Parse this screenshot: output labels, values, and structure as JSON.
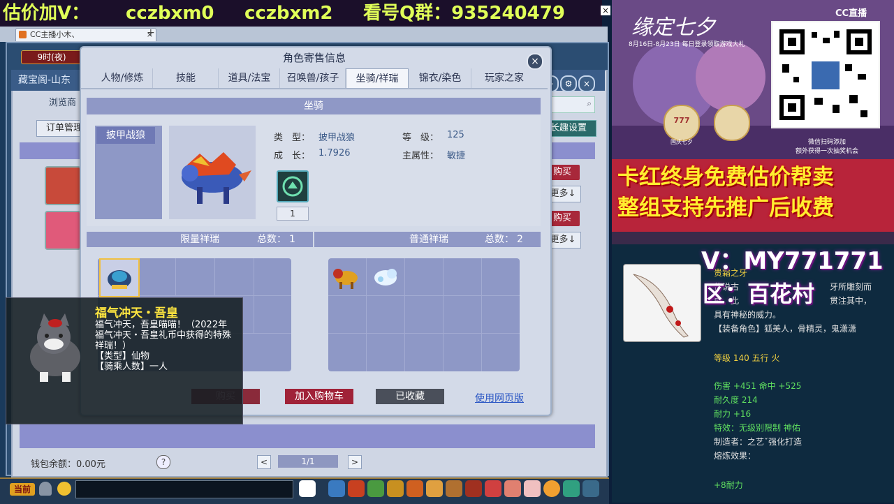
{
  "banner": {
    "part1": "估价加V：",
    "part2": "cczbxm0",
    "part3": "cczbxm2",
    "part4": "看号Q群：935240479"
  },
  "browser": {
    "tab_label": "CC主播小木、",
    "close_label": "×",
    "new_tab_label": "+"
  },
  "game": {
    "clock": "9时(夜)",
    "shop_title": "藏宝阁-山东",
    "browse_label": "浏览商",
    "order_label": "订单管理",
    "fav_setting_label": "长趣设置",
    "buy_label_1": "购买",
    "buy_label_2": "购买",
    "more_label_1": "更多↓",
    "more_label_2": "更多↓",
    "wallet_label": "钱包余额：0.00元",
    "help_label": "?",
    "prev_label": "<",
    "next_label": ">",
    "page_label": "1/1",
    "bottom_current": "当前"
  },
  "dialog": {
    "title": "角色寄售信息",
    "close_label": "×",
    "tabs": [
      {
        "label": "人物/修炼"
      },
      {
        "label": "技能"
      },
      {
        "label": "道具/法宝"
      },
      {
        "label": "召唤兽/孩子"
      },
      {
        "label": "坐骑/祥瑞"
      },
      {
        "label": "锦衣/染色"
      },
      {
        "label": "玩家之家"
      }
    ],
    "active_tab": "坐骑/祥瑞",
    "mount_header": "坐骑",
    "mount_selected": "披甲战狼",
    "mount": {
      "type_label": "类　型：",
      "type_value": "披甲战狼",
      "level_label": "等　级：",
      "level_value": "125",
      "growth_label": "成　长：",
      "growth_value": "1.7926",
      "attr_label": "主属性：",
      "attr_value": "敏捷",
      "skill_count": "1"
    },
    "limited": {
      "title": "限量祥瑞",
      "total_label": "总数：",
      "total": "1"
    },
    "normal": {
      "title": "普通祥瑞",
      "total_label": "总数：",
      "total": "2"
    },
    "buttons": {
      "buy": "购买",
      "cart": "加入购物车",
      "fav": "已收藏",
      "web": "使用网页版"
    },
    "tooltip": {
      "name": "福气冲天・吾皇",
      "desc": "福气冲天，吾皇喵喵！（2022年福气冲天・吾皇礼币中获得的特殊祥瑞！）\n【类型】仙物\n【骑乘人数】一人"
    }
  },
  "right": {
    "cc_brand": "CC直播",
    "promo_title": "缘定七夕",
    "promo_date": "8月16日-8月23日 每日登录领取游戏大礼",
    "promo_news": "微信扫码添加\n额外获得一次抽奖机会",
    "promo_badge": "777",
    "promo_badge_note": "国庆七夕",
    "line1": "卡红终身免费估价帮卖",
    "line2": "整组支持先推广后收费",
    "vid": "V：MY771771",
    "zone": "区：百花村",
    "item": {
      "name": "贵霜之牙",
      "desc1": "传说古",
      "desc1b": "牙所雕刻而",
      "desc2": "成，此",
      "desc2b": "贯注其中，",
      "desc3": "具有神秘的威力。",
      "roles": "【装备角色】狐美人，骨精灵，鬼潇潇",
      "level": "等级 140 五行 火",
      "stat1": "伤害 +451 命中 +525",
      "durability": "耐久度 214",
      "stat2": "耐力 +16",
      "effect": "特效：无级别限制 神佑",
      "maker": "制造者：之艺ˇ强化打造",
      "refine": "熔炼效果：",
      "refine_value": "+8耐力"
    }
  },
  "colors": {
    "banner_text": "#e0ff58",
    "accent_red": "#a02238",
    "header_blue": "#8f98c6",
    "highlight_yellow": "#ffee30"
  }
}
